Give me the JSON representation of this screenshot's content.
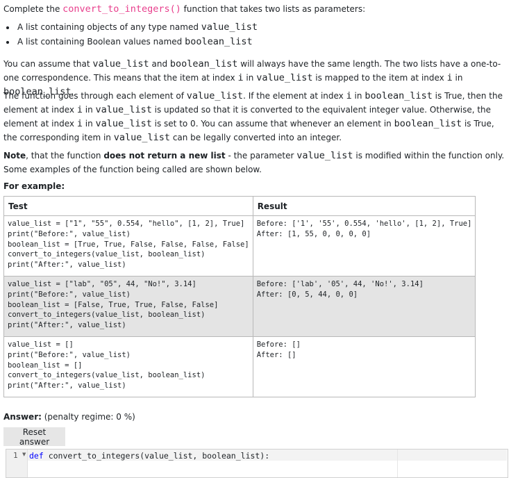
{
  "intro": {
    "prefix": "Complete the ",
    "func": "convert_to_integers()",
    "suffix": " function that takes two lists as parameters:"
  },
  "bullets": [
    {
      "text": "A list containing objects of any type named ",
      "code": "value_list"
    },
    {
      "text": "A list containing Boolean values named ",
      "code": "boolean_list"
    }
  ],
  "para2": {
    "a": "You can assume that ",
    "b": "value_list",
    "c": " and ",
    "d": "boolean_list",
    "e": " will always have the same length. The two lists have a one-to-one correspondence. This means that the item at index ",
    "f": "i",
    "g": " in ",
    "h": "value_list",
    "i": " is mapped to the item at index ",
    "j": "i",
    "k": " in ",
    "l": "boolean_list",
    "m": "."
  },
  "para3": {
    "a": "The function goes through each element of ",
    "b": "value_list",
    "c": ". If the element at index ",
    "d": "i",
    "e": " in ",
    "f": "boolean_list",
    "g": " is True, then the element at index ",
    "h": "i",
    "i": " in ",
    "j": "value_list",
    "k": " is updated so that it is converted to the equivalent integer value. Otherwise, the element at index ",
    "l": "i",
    "m": " in ",
    "n": "value_list",
    "o": " is set to 0. You can assume that whenever an element in ",
    "p": "boolean_list",
    "q": " is True, the corresponding item in ",
    "r": "value_list",
    "s": " can be legally converted into an integer."
  },
  "para4": {
    "note": "Note",
    "a": ", that the function ",
    "bold": "does not return a new list",
    "b": " - the parameter ",
    "code": "value_list",
    "c": " is modified within the function only. Some examples of the function being called are shown below."
  },
  "for_example": "For example:",
  "table": {
    "headers": [
      "Test",
      "Result"
    ],
    "rows": [
      {
        "test": "value_list = [\"1\", \"55\", 0.554, \"hello\", [1, 2], True]\nprint(\"Before:\", value_list)\nboolean_list = [True, True, False, False, False, False]\nconvert_to_integers(value_list, boolean_list)\nprint(\"After:\", value_list)",
        "result": "Before: ['1', '55', 0.554, 'hello', [1, 2], True]\nAfter: [1, 55, 0, 0, 0, 0]"
      },
      {
        "test": "value_list = [\"lab\", \"05\", 44, \"No!\", 3.14]\nprint(\"Before:\", value_list)\nboolean_list = [False, True, True, False, False]\nconvert_to_integers(value_list, boolean_list)\nprint(\"After:\", value_list)",
        "result": "Before: ['lab', '05', 44, 'No!', 3.14]\nAfter: [0, 5, 44, 0, 0]"
      },
      {
        "test": "value_list = []\nprint(\"Before:\", value_list)\nboolean_list = []\nconvert_to_integers(value_list, boolean_list)\nprint(\"After:\", value_list)",
        "result": "Before: []\nAfter: []"
      }
    ]
  },
  "answer": {
    "label": "Answer:",
    "penalty": "(penalty regime: 0 %)"
  },
  "reset_button": "Reset answer",
  "editor": {
    "line_number": "1",
    "keyword": "def",
    "code_rest": " convert_to_integers(value_list, boolean_list):"
  }
}
